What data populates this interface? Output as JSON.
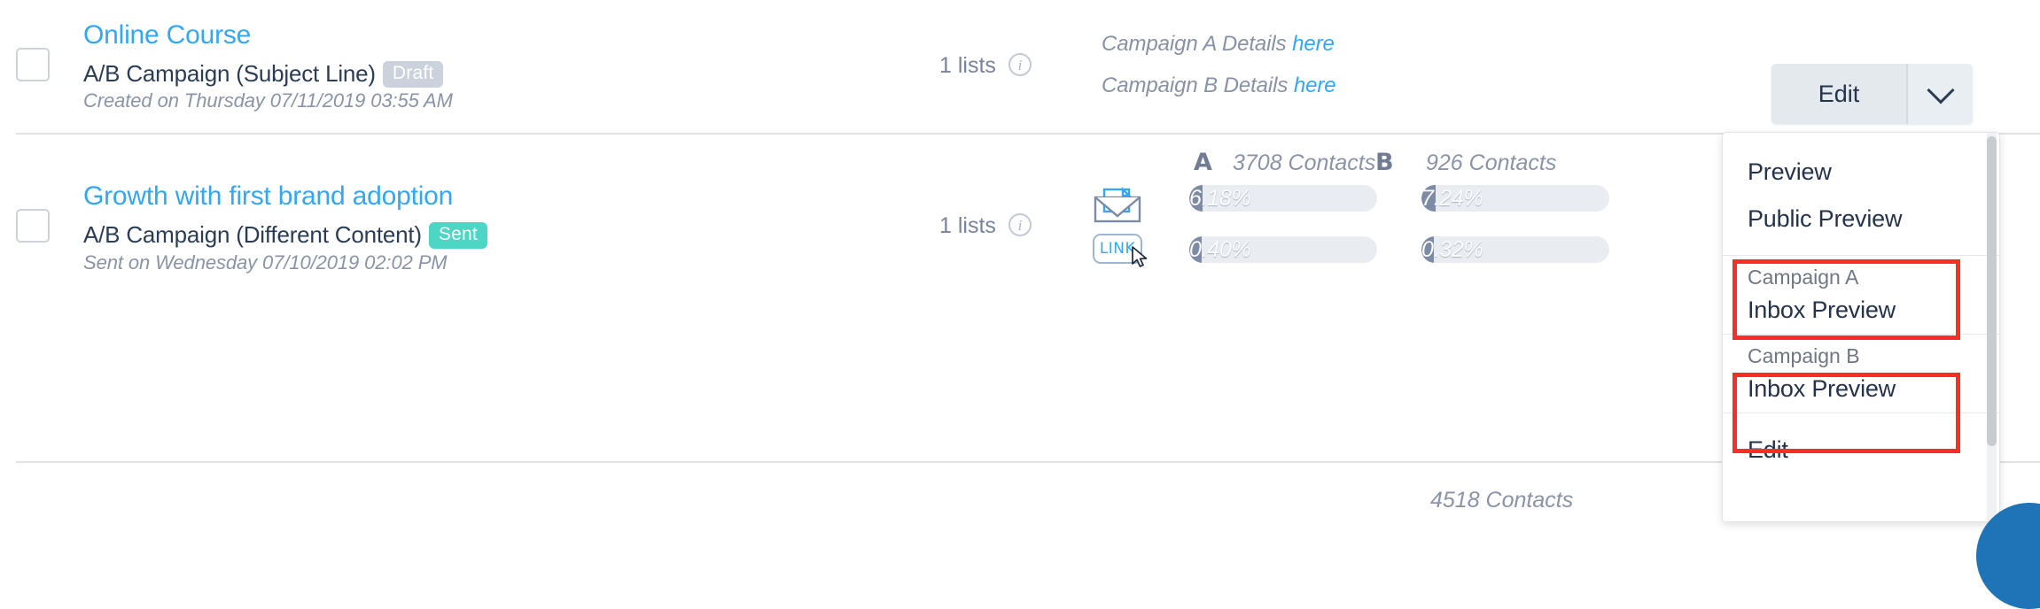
{
  "campaigns": [
    {
      "title": "Online Course",
      "subtitle": "A/B Campaign (Subject Line)",
      "status_badge": "Draft",
      "date_text": "Created on Thursday 07/11/2019 03:55 AM",
      "lists_label": "1 lists",
      "info_icon": "info-icon",
      "details": [
        {
          "text": "Campaign A Details",
          "link": "here"
        },
        {
          "text": "Campaign B Details",
          "link": "here"
        }
      ]
    },
    {
      "title": "Growth with first brand adoption",
      "subtitle": "A/B Campaign (Different Content)",
      "status_badge": "Sent",
      "date_text": "Sent on Wednesday 07/10/2019 02:02 PM",
      "lists_label": "1 lists",
      "info_icon": "info-icon",
      "stats": {
        "variant_a_letter": "A",
        "variant_a_contacts": "3708 Contacts",
        "variant_b_letter": "B",
        "variant_b_contacts": "926 Contacts",
        "open_icon": "open-envelope-icon",
        "click_icon": "link-icon",
        "open_rate_a": "6.18%",
        "open_rate_b": "7.24%",
        "click_rate_a": "0.40%",
        "click_rate_b": "0.32%",
        "open_rate_a_value": 6.18,
        "open_rate_b_value": 7.24,
        "click_rate_a_value": 0.4,
        "click_rate_b_value": 0.32
      }
    }
  ],
  "total_contacts": "4518 Contacts",
  "actions": {
    "edit_label": "Edit",
    "caret_icon": "chevron-down-icon"
  },
  "dropdown": {
    "items": [
      {
        "label": "Preview"
      },
      {
        "label": "Public Preview"
      },
      {
        "sublabel": "Campaign A",
        "label": "Inbox Preview",
        "highlighted": true
      },
      {
        "sublabel": "Campaign B",
        "label": "Inbox Preview",
        "highlighted": true
      },
      {
        "label": "Edit"
      }
    ]
  },
  "colors": {
    "link_blue": "#33a7f5",
    "title_navy": "#2b3d54",
    "muted_gray": "#8a94a6",
    "badge_draft": "#ccd2dc",
    "badge_sent": "#4ed6c4",
    "bar_fill": "#7d8ba5",
    "bar_track": "#e9ecf1",
    "highlight_red": "#fc2e20",
    "chat_blue": "#1f73b7"
  }
}
